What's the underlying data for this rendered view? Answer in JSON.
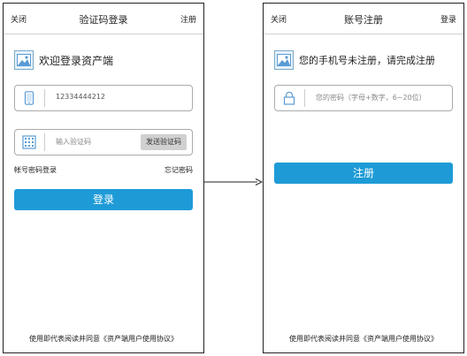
{
  "screen_login": {
    "top_left": "关闭",
    "title": "验证码登录",
    "top_right": "注册",
    "welcome": "欢迎登录资产端",
    "phone_value": "12334444212",
    "code_placeholder": "输入验证码",
    "send_code_label": "发送验证码",
    "account_login": "帐号密码登录",
    "forgot_password": "忘记密码",
    "login_button": "登录",
    "footer": "使用即代表阅读并同意《资产端用户使用协议》"
  },
  "screen_register": {
    "top_left": "关闭",
    "title": "账号注册",
    "top_right": "登录",
    "message": "您的手机号未注册，请完成注册",
    "password_placeholder": "您的密码（字母+数字，6~20位）",
    "register_button": "注册",
    "footer": "使用即代表阅读并同意《资产端用户使用协议》"
  },
  "colors": {
    "primary": "#1e9bd7",
    "icon_blue": "#5a9bd5"
  }
}
